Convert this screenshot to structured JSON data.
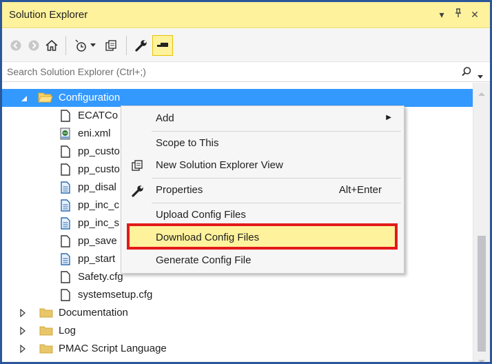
{
  "window": {
    "title": "Solution Explorer",
    "dropdown_glyph": "▾",
    "pin_glyph": "ᵽ",
    "close_glyph": "✕"
  },
  "toolbar": {
    "icons": [
      "back-icon",
      "forward-icon",
      "home-icon",
      "history-icon",
      "dropdown-icon",
      "sync-view-icon",
      "properties-wrench-icon",
      "preview-pin-icon"
    ]
  },
  "search": {
    "placeholder": "Search Solution Explorer (Ctrl+;)"
  },
  "tree": {
    "items": [
      {
        "label": "Configuration",
        "selected": true,
        "icon": "folder-open-icon",
        "expanded": true
      },
      {
        "label": "ECATCo",
        "icon": "file-icon"
      },
      {
        "label": "eni.xml",
        "icon": "xml-file-icon"
      },
      {
        "label": "pp_custo",
        "icon": "file-icon"
      },
      {
        "label": "pp_custo",
        "icon": "file-icon"
      },
      {
        "label": "pp_disal",
        "icon": "text-file-icon"
      },
      {
        "label": "pp_inc_c",
        "icon": "text-file-icon"
      },
      {
        "label": "pp_inc_s",
        "icon": "text-file-icon"
      },
      {
        "label": "pp_save",
        "icon": "file-icon"
      },
      {
        "label": "pp_start",
        "icon": "text-file-icon"
      },
      {
        "label": "Safety.cfg",
        "icon": "file-icon"
      },
      {
        "label": "systemsetup.cfg",
        "icon": "file-icon"
      },
      {
        "label": "Documentation",
        "icon": "folder-icon"
      },
      {
        "label": "Log",
        "icon": "folder-icon"
      },
      {
        "label": "PMAC Script Language",
        "icon": "folder-icon"
      }
    ]
  },
  "context_menu": {
    "items": [
      {
        "label": "Add",
        "submenu_glyph": "▶"
      },
      {
        "label": "Scope to This"
      },
      {
        "label": "New Solution Explorer View"
      },
      {
        "label": "Properties",
        "shortcut": "Alt+Enter"
      },
      {
        "label": "Upload Config Files"
      },
      {
        "label": "Download Config Files",
        "highlighted": true
      },
      {
        "label": "Generate Config File"
      }
    ]
  },
  "colors": {
    "title_bar": "#fff29d",
    "selection": "#3399ff",
    "highlight_border": "#e21a1a",
    "window_border": "#2b579a"
  }
}
